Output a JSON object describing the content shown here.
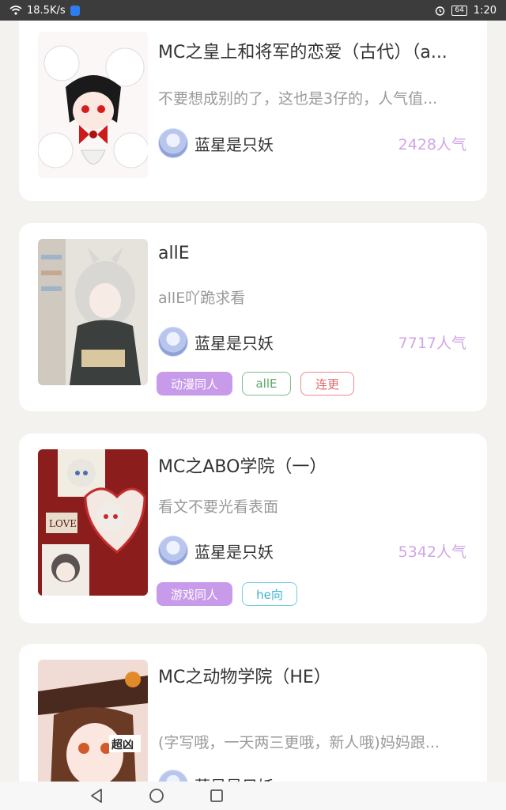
{
  "status": {
    "speed": "18.5K/s",
    "battery": "64",
    "time": "1:20"
  },
  "cards": [
    {
      "title": "MC之皇上和将军的恋爱（古代）（a...",
      "desc": "不要想成别的了，这也是3仔的，人气值...",
      "author": "蓝星是只妖",
      "popularity": "2428人气",
      "tags": []
    },
    {
      "title": "allE",
      "desc": "allE吖跪求看",
      "author": "蓝星是只妖",
      "popularity": "7717人气",
      "tags": [
        "动漫同人",
        "allE",
        "连更"
      ]
    },
    {
      "title": "MC之ABO学院（一）",
      "desc": "看文不要光看表面",
      "author": "蓝星是只妖",
      "popularity": "5342人气",
      "tags": [
        "游戏同人",
        "he向"
      ]
    },
    {
      "title": "MC之动物学院（HE）",
      "desc": "(字写哦，一天两三更哦，新人哦)妈妈跟...",
      "author": "蓝星是只妖",
      "popularity": "",
      "tags": []
    }
  ],
  "colors": {
    "accent": "#c89bea",
    "popularity": "#d0a6e6",
    "background": "#f4f2ee"
  }
}
